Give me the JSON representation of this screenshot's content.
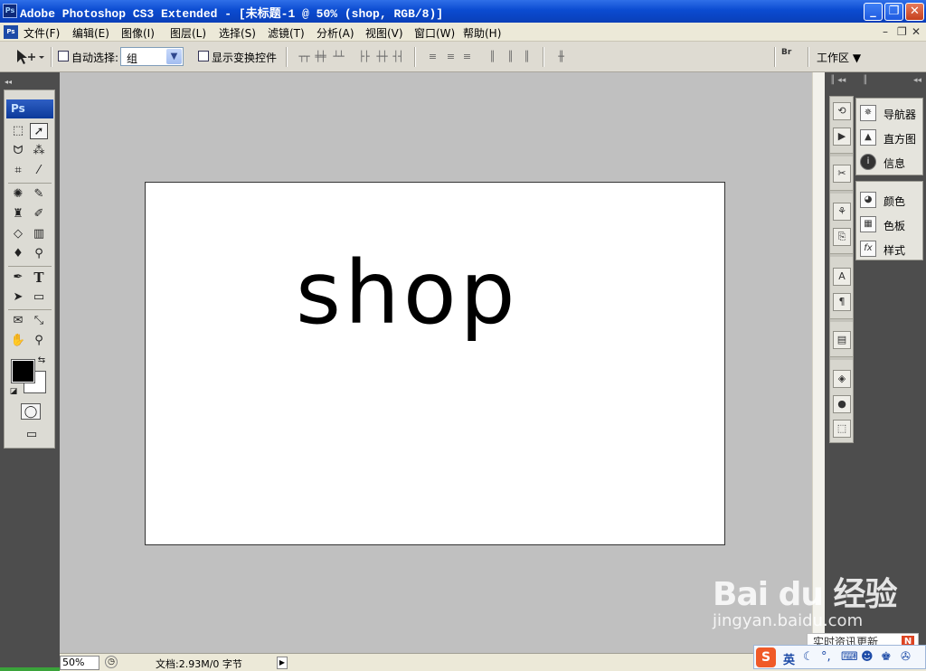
{
  "window": {
    "title": "Adobe Photoshop CS3 Extended - [未标题-1 @ 50% (shop, RGB/8)]",
    "app_icon": "Ps",
    "buttons": {
      "minimize": "_",
      "restore": "❐",
      "close": "✕"
    }
  },
  "menubar": {
    "doc_icon": "Ps",
    "items": [
      "文件(F)",
      "编辑(E)",
      "图像(I)",
      "图层(L)",
      "选择(S)",
      "滤镜(T)",
      "分析(A)",
      "视图(V)",
      "窗口(W)",
      "帮助(H)"
    ],
    "mdi": {
      "minimize": "–",
      "restore": "❐",
      "close": "✕"
    }
  },
  "options": {
    "tool_icon": "move-tool-icon",
    "auto_select_label": "自动选择:",
    "auto_select_value": "组",
    "show_transform_label": "显示变换控件",
    "workspace_label": "工作区 ▼",
    "bridge_icon": "Br"
  },
  "tools": {
    "logo": "Ps"
  },
  "canvas": {
    "text": "shop",
    "background": "#ffffff"
  },
  "panels": {
    "group1": [
      "导航器",
      "直方图",
      "信息"
    ],
    "group2": [
      "颜色",
      "色板",
      "样式"
    ]
  },
  "status": {
    "zoom": "50%",
    "doc_info": "文档:2.93M/0 字节"
  },
  "watermark": {
    "brand": "Bai du 经验",
    "url": "jingyan.baidu.com"
  },
  "news": {
    "text": "实时资讯更新",
    "badge": "N"
  },
  "ime": {
    "logo": "S",
    "lang": "英"
  },
  "colors": {
    "titlebar": "#0b4bd1",
    "canvas_bg": "#c0c0c0",
    "accent": "#2e5fc4"
  }
}
